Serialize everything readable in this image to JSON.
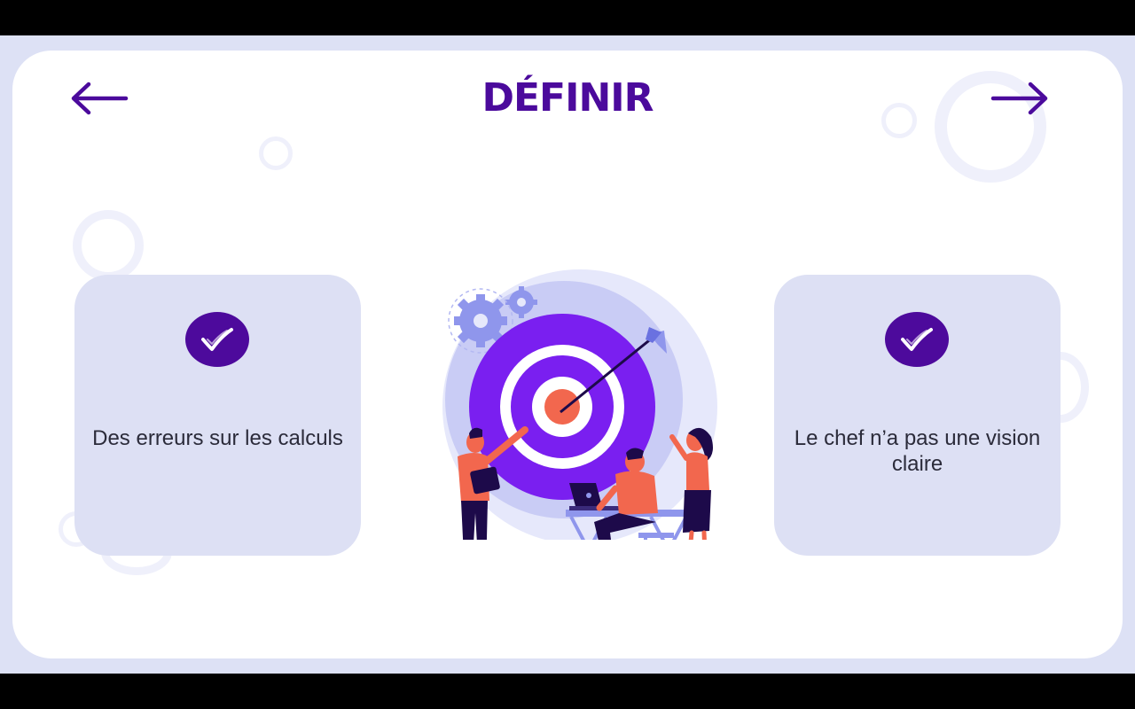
{
  "slide": {
    "title": "DÉFINIR",
    "nav": {
      "back_icon": "arrow-left-icon",
      "next_icon": "arrow-right-icon"
    },
    "cards": [
      {
        "icon": "check-icon",
        "text": "Des erreurs sur les calculs"
      },
      {
        "icon": "check-icon",
        "text": "Le chef n’a pas une vision claire"
      }
    ],
    "illustration": "target-team-illustration"
  },
  "colors": {
    "brand_purple": "#4b0a9c",
    "card_bg": "#dde0f4",
    "target_violet": "#7a1ff0",
    "accent_coral": "#f2674e"
  }
}
